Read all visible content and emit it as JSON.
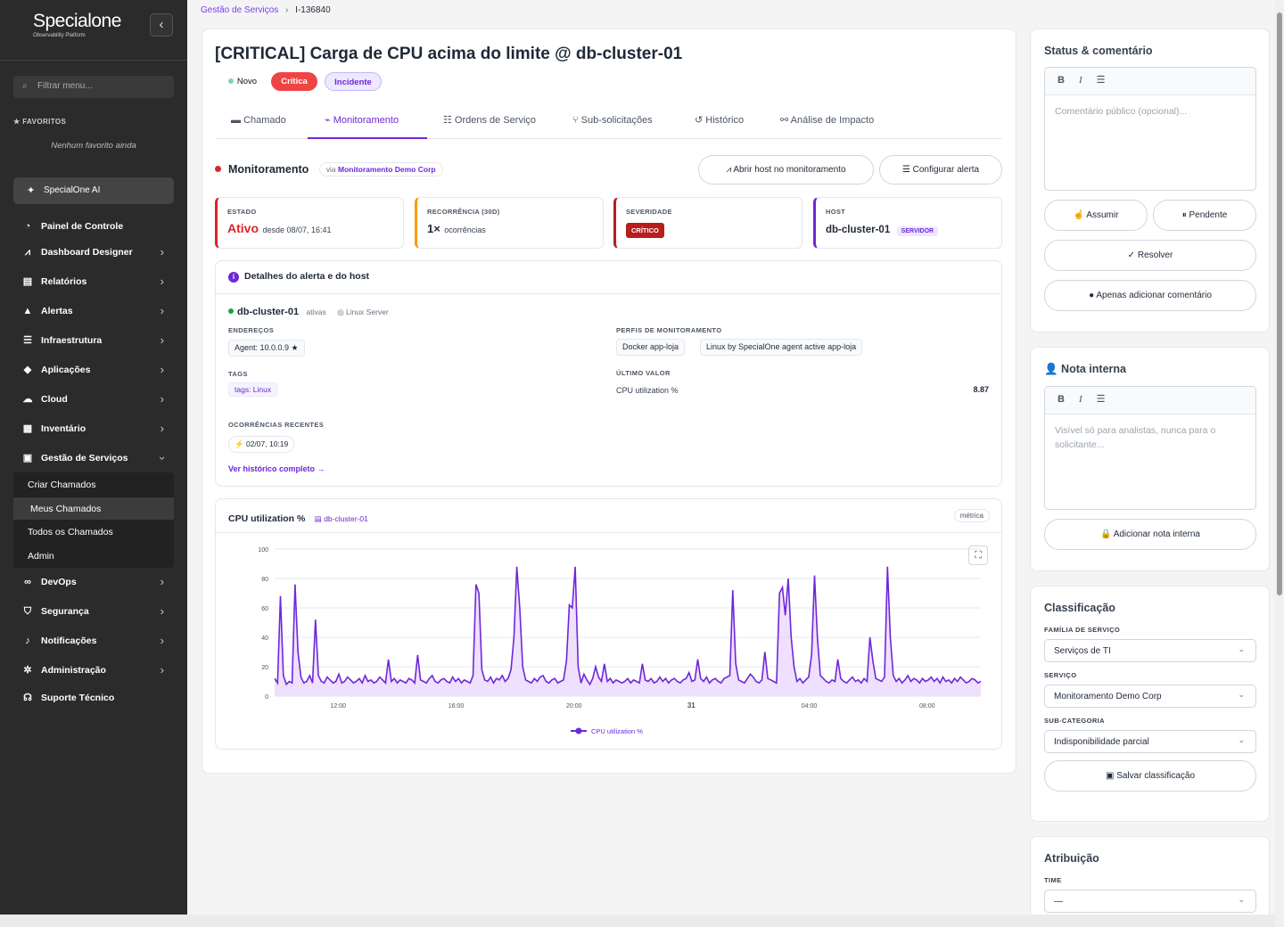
{
  "app": {
    "logo": "Specialone",
    "logo_sub": "Observability Platform"
  },
  "sidebar": {
    "filter_placeholder": "Filtrar menu...",
    "favorites_header": "FAVORITOS",
    "favorites_empty": "Nenhum favorito ainda",
    "ai_label": "SpecialOne AI",
    "items": [
      {
        "label": "Painel de Controle",
        "icon": "dashboard-icon"
      },
      {
        "label": "Dashboard Designer",
        "icon": "chart-line-icon"
      },
      {
        "label": "Relatórios",
        "icon": "file-icon"
      },
      {
        "label": "Alertas",
        "icon": "warning-icon"
      },
      {
        "label": "Infraestrutura",
        "icon": "server-icon"
      },
      {
        "label": "Aplicações",
        "icon": "cube-icon"
      },
      {
        "label": "Cloud",
        "icon": "cloud-icon"
      },
      {
        "label": "Inventário",
        "icon": "boxes-icon"
      },
      {
        "label": "Gestão de Serviços",
        "icon": "briefcase-icon"
      },
      {
        "label": "DevOps",
        "icon": "infinity-icon"
      },
      {
        "label": "Segurança",
        "icon": "shield-icon"
      },
      {
        "label": "Notificações",
        "icon": "bell-icon"
      },
      {
        "label": "Administração",
        "icon": "gear-icon"
      },
      {
        "label": "Suporte Técnico",
        "icon": "headset-icon"
      }
    ],
    "subitems": [
      "Criar Chamados",
      "Meus Chamados",
      "Todos os Chamados",
      "Admin"
    ],
    "active_subitem": "Meus Chamados"
  },
  "breadcrumb": {
    "parent": "Gestão de Serviços",
    "current": "I-136840"
  },
  "ticket": {
    "title": "[CRITICAL] Carga de CPU acima do limite @ db-cluster-01",
    "status": "Novo",
    "priority": "Crítica",
    "type": "Incidente"
  },
  "tabs": [
    "Chamado",
    "Monitoramento",
    "Ordens de Serviço",
    "Sub-solicitações",
    "Histórico",
    "Análise de Impacto"
  ],
  "active_tab": "Monitoramento",
  "monitoring": {
    "title": "Monitoramento",
    "via_prefix": "via",
    "via_source": "Monitoramento Demo Corp",
    "btn_open_host": "Abrir host no monitoramento",
    "btn_config_alert": "Configurar alerta",
    "stats": {
      "estado_label": "ESTADO",
      "estado_value": "Ativo",
      "estado_since": "desde 08/07, 16:41",
      "recorrencia_label": "RECORRÊNCIA (30D)",
      "recorrencia_value": "1×",
      "recorrencia_unit": "ocorrências",
      "severidade_label": "SEVERIDADE",
      "severidade_value": "CRÍTICO",
      "host_label": "HOST",
      "host_value": "db-cluster-01",
      "host_tag": "SERVIDOR"
    },
    "details": {
      "header": "Detalhes do alerta e do host",
      "host": "db-cluster-01",
      "host_state": "ativas",
      "host_os": "Linux Server",
      "addresses_label": "ENDEREÇOS",
      "address": "Agent: 10.0.0.9 ★",
      "profiles_label": "PERFIS DE MONITORAMENTO",
      "profiles": [
        "Docker app-loja",
        "Linux by SpecialOne agent active app-loja"
      ],
      "tags_label": "TAGS",
      "tag": "tags: Linux",
      "last_value_label": "ÚLTIMO VALOR",
      "last_metric": "CPU utilization %",
      "last_value": "8.87",
      "recent_label": "OCORRÊNCIAS RECENTES",
      "recent": "02/07, 10:19",
      "history_link": "Ver histórico completo →"
    }
  },
  "chart_data": {
    "type": "area",
    "title": "CPU utilization %",
    "host": "db-cluster-01",
    "tag": "métrica",
    "ylim": [
      0,
      100
    ],
    "yticks": [
      0,
      20,
      40,
      60,
      80,
      100
    ],
    "xticks": [
      "12:00",
      "16:00",
      "20:00",
      "31",
      "04:00",
      "08:00"
    ],
    "series": [
      {
        "name": "CPU utilization %",
        "color": "#6d28d9",
        "values": [
          12,
          9,
          68,
          14,
          8,
          10,
          9,
          76,
          30,
          13,
          9,
          10,
          14,
          9,
          52,
          14,
          10,
          9,
          13,
          11,
          9,
          10,
          15,
          9,
          10,
          13,
          11,
          9,
          10,
          12,
          9,
          14,
          10,
          11,
          9,
          10,
          13,
          11,
          9,
          25,
          10,
          12,
          9,
          11,
          10,
          9,
          12,
          11,
          9,
          28,
          11,
          10,
          9,
          12,
          14,
          10,
          9,
          11,
          12,
          10,
          9,
          13,
          10,
          12,
          9,
          11,
          10,
          9,
          14,
          76,
          70,
          18,
          11,
          10,
          13,
          9,
          12,
          11,
          14,
          10,
          12,
          18,
          40,
          88,
          60,
          20,
          11,
          10,
          9,
          12,
          10,
          13,
          14,
          10,
          9,
          11,
          12,
          9,
          10,
          11,
          24,
          62,
          60,
          88,
          20,
          9,
          15,
          11,
          8,
          12,
          20,
          13,
          10,
          22,
          10,
          12,
          9,
          11,
          10,
          9,
          10,
          12,
          9,
          11,
          10,
          9,
          22,
          11,
          10,
          12,
          9,
          10,
          13,
          10,
          12,
          9,
          11,
          12,
          10,
          9,
          11,
          12,
          16,
          10,
          11,
          25,
          12,
          10,
          13,
          9,
          11,
          12,
          10,
          9,
          12,
          13,
          14,
          72,
          22,
          11,
          10,
          9,
          12,
          15,
          13,
          10,
          9,
          11,
          30,
          12,
          11,
          10,
          9,
          70,
          74,
          55,
          80,
          40,
          20,
          10,
          12,
          9,
          11,
          13,
          28,
          82,
          40,
          14,
          12,
          10,
          9,
          11,
          10,
          25,
          12,
          10,
          9,
          11,
          13,
          10,
          11,
          9,
          12,
          10,
          40,
          24,
          12,
          11,
          10,
          13,
          88,
          40,
          14,
          10,
          12,
          9,
          11,
          14,
          10,
          12,
          11,
          9,
          12,
          10,
          11,
          13,
          10,
          12,
          9,
          13,
          10,
          11,
          9,
          12,
          10,
          13,
          11,
          9,
          10,
          12,
          11,
          9,
          10
        ]
      }
    ]
  },
  "right": {
    "status": {
      "title": "Status & comentário",
      "placeholder": "Comentário público (opcional)...",
      "btn_assume": "Assumir",
      "btn_pending": "Pendente",
      "btn_resolve": "Resolver",
      "btn_comment": "Apenas adicionar comentário"
    },
    "note": {
      "title": "Nota interna",
      "placeholder": "Visível só para analistas, nunca para o solicitante...",
      "btn_add": "Adicionar nota interna"
    },
    "classification": {
      "title": "Classificação",
      "family_label": "FAMÍLIA DE SERVIÇO",
      "family_value": "Serviços de TI",
      "service_label": "SERVIÇO",
      "service_value": "Monitoramento Demo Corp",
      "subcat_label": "SUB-CATEGORIA",
      "subcat_value": "Indisponibilidade parcial",
      "btn_save": "Salvar classificação"
    },
    "assignment": {
      "title": "Atribuição",
      "team_label": "TIME",
      "team_value": "—"
    }
  },
  "colors": {
    "accent": "#6d28d9",
    "critical": "#ef4444",
    "dark_red": "#b91c1c",
    "sidebar": "#2b2b2b"
  }
}
